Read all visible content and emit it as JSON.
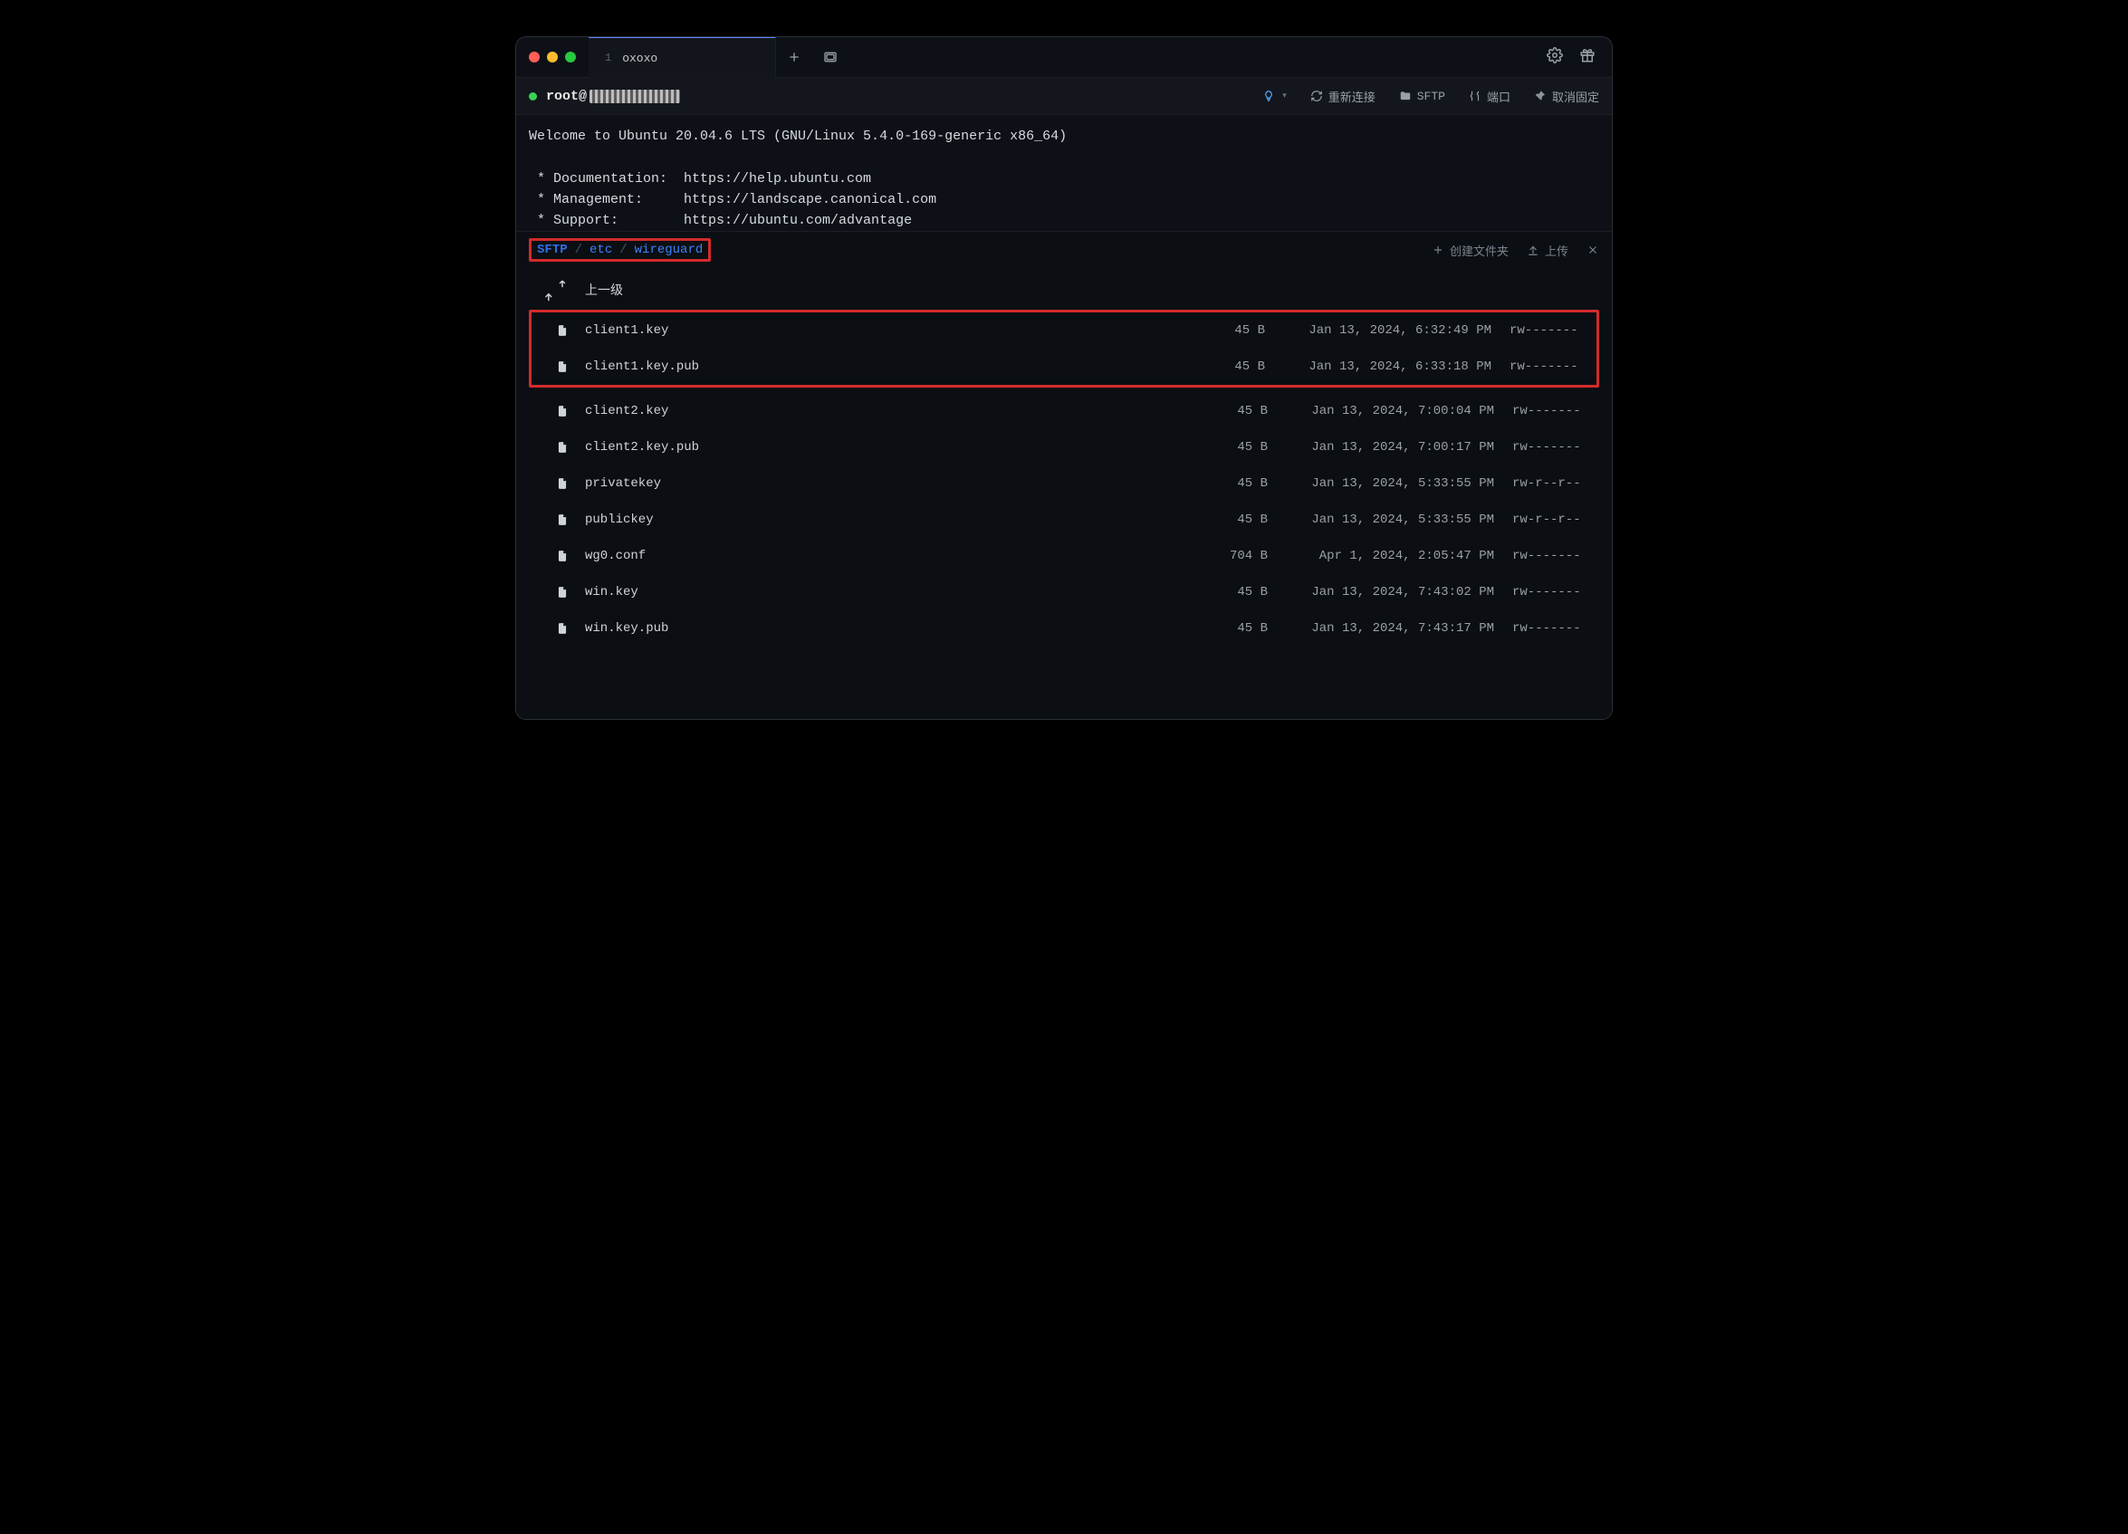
{
  "title_tab": {
    "index": "1",
    "name": "oxoxo"
  },
  "session": {
    "host_prefix": "root@",
    "actions": {
      "reconnect": "重新连接",
      "sftp": "SFTP",
      "port": "端口",
      "unpin": "取消固定"
    }
  },
  "motd": "Welcome to Ubuntu 20.04.6 LTS (GNU/Linux 5.4.0-169-generic x86_64)\n\n * Documentation:  https://help.ubuntu.com\n * Management:     https://landscape.canonical.com\n * Support:        https://ubuntu.com/advantage",
  "sftp": {
    "crumbs": [
      "SFTP",
      "etc",
      "wireguard"
    ],
    "actions": {
      "mkdir": "创建文件夹",
      "upload": "上传"
    },
    "up_label": "上一级",
    "files": [
      {
        "name": "client1.key",
        "size": "45 B",
        "date": "Jan 13, 2024, 6:32:49 PM",
        "perm": "rw-------",
        "hl": true
      },
      {
        "name": "client1.key.pub",
        "size": "45 B",
        "date": "Jan 13, 2024, 6:33:18 PM",
        "perm": "rw-------",
        "hl": true
      },
      {
        "name": "client2.key",
        "size": "45 B",
        "date": "Jan 13, 2024, 7:00:04 PM",
        "perm": "rw-------"
      },
      {
        "name": "client2.key.pub",
        "size": "45 B",
        "date": "Jan 13, 2024, 7:00:17 PM",
        "perm": "rw-------"
      },
      {
        "name": "privatekey",
        "size": "45 B",
        "date": "Jan 13, 2024, 5:33:55 PM",
        "perm": "rw-r--r--"
      },
      {
        "name": "publickey",
        "size": "45 B",
        "date": "Jan 13, 2024, 5:33:55 PM",
        "perm": "rw-r--r--"
      },
      {
        "name": "wg0.conf",
        "size": "704 B",
        "date": "Apr 1, 2024, 2:05:47 PM",
        "perm": "rw-------"
      },
      {
        "name": "win.key",
        "size": "45 B",
        "date": "Jan 13, 2024, 7:43:02 PM",
        "perm": "rw-------"
      },
      {
        "name": "win.key.pub",
        "size": "45 B",
        "date": "Jan 13, 2024, 7:43:17 PM",
        "perm": "rw-------"
      }
    ]
  }
}
